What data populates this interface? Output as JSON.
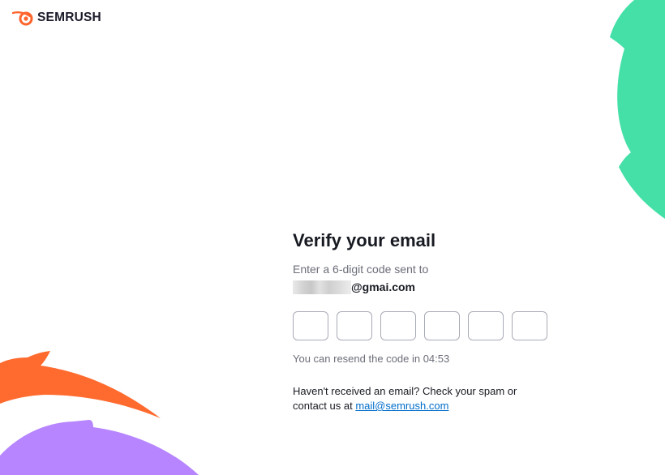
{
  "brand": {
    "name": "SEMRUSH",
    "accent": "#ff642d"
  },
  "verify": {
    "title": "Verify your email",
    "subtitle": "Enter a 6-digit code sent to",
    "email_domain": "@gmai.com",
    "code_digits": [
      "",
      "",
      "",
      "",
      "",
      ""
    ],
    "resend_text": "You can resend the code in 04:53",
    "help_text": "Haven't received an email? Check your spam or contact us at",
    "contact_email": "mail@semrush.com"
  },
  "colors": {
    "green": "#44e0a7",
    "orange": "#ff6b2f",
    "purple": "#b685ff",
    "link": "#006dca"
  }
}
